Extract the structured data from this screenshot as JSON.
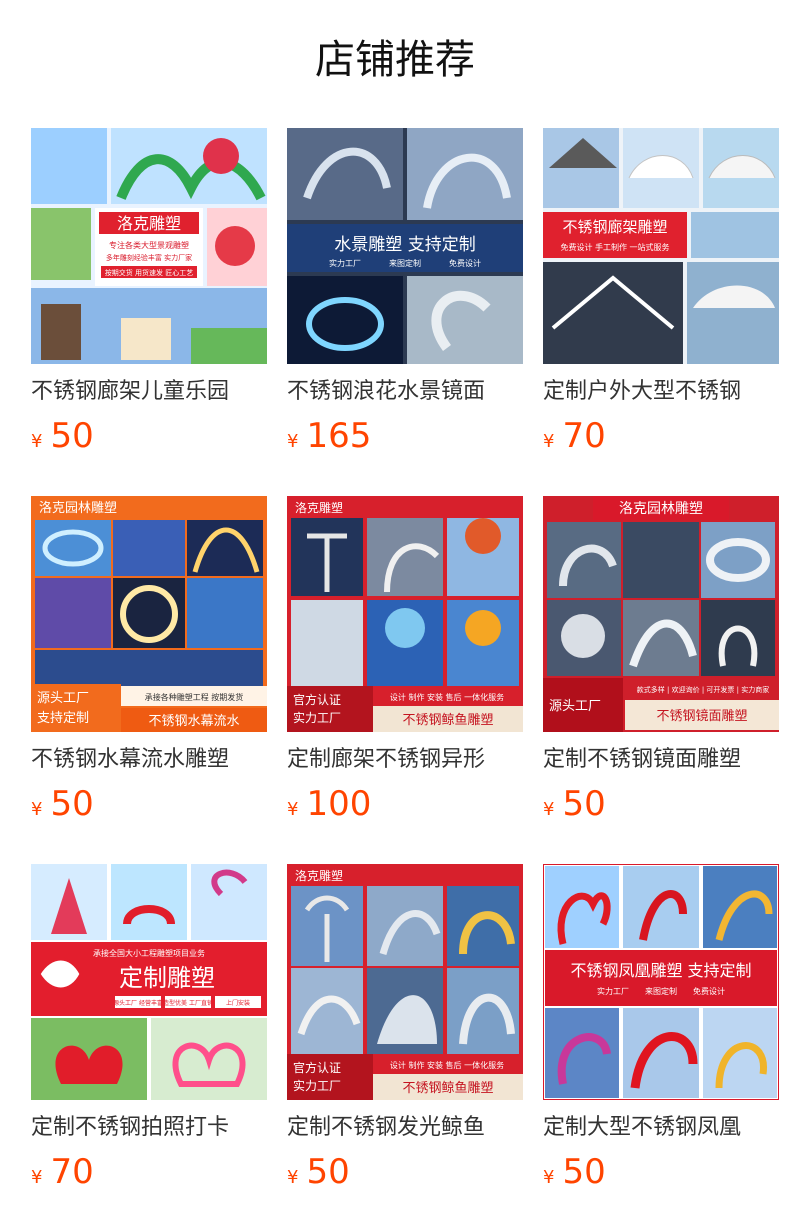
{
  "page_title": "店铺推荐",
  "products": [
    {
      "name": "不锈钢廊架儿童乐园",
      "currency": "¥",
      "price": "50",
      "image": {
        "badge": "洛克雕塑",
        "lines": [
          "专注各类大型景观雕塑",
          "多年雕刻经验丰富 实力厂家",
          "按期交货 用货速发 匠心工艺"
        ]
      }
    },
    {
      "name": "不锈钢浪花水景镜面",
      "currency": "¥",
      "price": "165",
      "image": {
        "badge": "水景雕塑 支持定制",
        "lines": [
          "实力工厂",
          "来图定制",
          "免费设计"
        ]
      }
    },
    {
      "name": "定制户外大型不锈钢",
      "currency": "¥",
      "price": "70",
      "image": {
        "badge": "不锈钢廊架雕塑",
        "lines": [
          "免费设计 手工制作 一站式服务"
        ]
      }
    },
    {
      "name": "不锈钢水幕流水雕塑",
      "currency": "¥",
      "price": "50",
      "image": {
        "badge": "洛克园林雕塑",
        "lines": [
          "源头工厂",
          "支持定制",
          "承接各种雕塑工程 按期发货",
          "不锈钢水幕流水"
        ]
      }
    },
    {
      "name": "定制廊架不锈钢异形",
      "currency": "¥",
      "price": "100",
      "image": {
        "badge": "洛克雕塑",
        "lines": [
          "官方认证",
          "实力工厂",
          "设计 制作 安装 售后 一体化服务",
          "不锈钢鲸鱼雕塑"
        ]
      }
    },
    {
      "name": "定制不锈钢镜面雕塑",
      "currency": "¥",
      "price": "50",
      "image": {
        "badge": "洛克园林雕塑",
        "lines": [
          "源头工厂",
          "款式多样 | 欢迎询价 | 可开发票 | 实力商家",
          "不锈钢镜面雕塑"
        ]
      }
    },
    {
      "name": "定制不锈钢拍照打卡",
      "currency": "¥",
      "price": "70",
      "image": {
        "badge": "定制雕塑",
        "lines": [
          "承接全国大小工程雕塑项目业务",
          "源头工厂 经营丰富",
          "造型优美 工厂直销",
          "上门安装"
        ]
      }
    },
    {
      "name": "定制不锈钢发光鲸鱼",
      "currency": "¥",
      "price": "50",
      "image": {
        "badge": "洛克雕塑",
        "lines": [
          "官方认证",
          "实力工厂",
          "设计 制作 安装 售后 一体化服务",
          "不锈钢鲸鱼雕塑"
        ]
      }
    },
    {
      "name": "定制大型不锈钢凤凰",
      "currency": "¥",
      "price": "50",
      "image": {
        "badge": "不锈钢凤凰雕塑 支持定制",
        "lines": [
          "实力工厂",
          "来图定制",
          "免费设计"
        ]
      }
    }
  ],
  "colors": {
    "price": "#ff4400",
    "brand_red": "#d9192a",
    "title": "#111111"
  }
}
